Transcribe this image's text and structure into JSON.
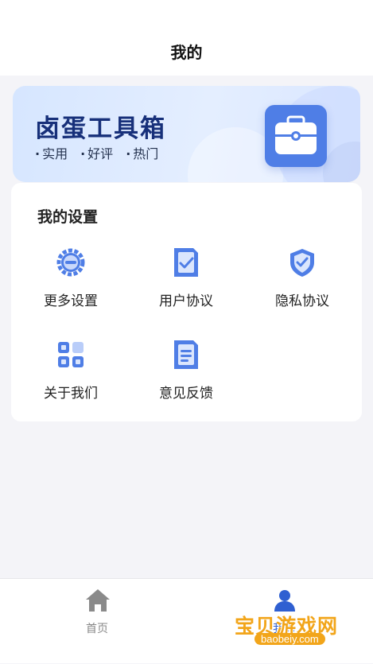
{
  "header": {
    "title": "我的"
  },
  "banner": {
    "title": "卤蛋工具箱",
    "tags": [
      "实用",
      "好评",
      "热门"
    ]
  },
  "settings": {
    "title": "我的设置",
    "items": [
      {
        "label": "更多设置",
        "icon": "gear-icon"
      },
      {
        "label": "用户协议",
        "icon": "document-check-icon"
      },
      {
        "label": "隐私协议",
        "icon": "shield-check-icon"
      },
      {
        "label": "关于我们",
        "icon": "grid-apps-icon"
      },
      {
        "label": "意见反馈",
        "icon": "feedback-document-icon"
      }
    ]
  },
  "tabbar": {
    "tabs": [
      {
        "label": "首页",
        "icon": "home-icon",
        "active": false
      },
      {
        "label": "我的",
        "icon": "profile-icon",
        "active": true
      }
    ]
  },
  "watermark": {
    "text": "宝贝游戏网",
    "url": "baobeiy.com"
  },
  "colors": {
    "accent": "#4f7ee6",
    "banner_title": "#17307a",
    "background": "#f4f4f8"
  }
}
